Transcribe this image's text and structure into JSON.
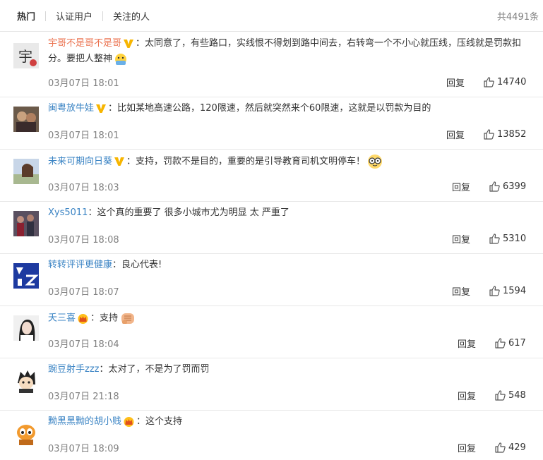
{
  "tabs": [
    "热门",
    "认证用户",
    "关注的人"
  ],
  "total": "共4491条",
  "comments": [
    {
      "user": "宇哥不是哥不是哥",
      "badge": "v",
      "text": "：太同意了，有些路口，实线恨不得划到路中间去，右转弯一个不小心就压线，压线就是罚款扣分。要把人整神",
      "emoji": "yellow",
      "time": "03月07日 18:01",
      "reply": "回复",
      "likes": "14740"
    },
    {
      "user": "闽粤放牛娃",
      "badge": "v",
      "text": "：比如某地高速公路，120限速，然后就突然来个60限速，这就是以罚款为目的",
      "emoji": "",
      "time": "03月07日 18:01",
      "reply": "回复",
      "likes": "13852"
    },
    {
      "user": "未来可期向日葵",
      "badge": "v",
      "text": "：支持，罚款不是目的，重要的是引导教育司机文明停车！",
      "emoji": "glasses",
      "time": "03月07日 18:03",
      "reply": "回复",
      "likes": "6399"
    },
    {
      "user": "Xys5011",
      "badge": "",
      "text": "：这个真的重要了 很多小城市尤为明显 太 严重了",
      "emoji": "",
      "time": "03月07日 18:08",
      "reply": "回复",
      "likes": "5310"
    },
    {
      "user": "转转评评更健康",
      "badge": "",
      "text": "：良心代表!",
      "emoji": "",
      "time": "03月07日 18:07",
      "reply": "回复",
      "likes": "1594"
    },
    {
      "user": "夭三喜",
      "badge": "crown",
      "text": "：支持",
      "emoji": "fist",
      "time": "03月07日 18:04",
      "reply": "回复",
      "likes": "617"
    },
    {
      "user": "豌豆射手zzz",
      "badge": "",
      "text": "：太对了，不是为了罚而罚",
      "emoji": "",
      "time": "03月07日 21:18",
      "reply": "回复",
      "likes": "548"
    },
    {
      "user": "黝黑黑黝的胡小贱",
      "badge": "crown",
      "text": "：这个支持",
      "emoji": "",
      "time": "03月07日 18:09",
      "reply": "回复",
      "likes": "429"
    }
  ],
  "icons": {
    "badge_v": "verified-v-icon",
    "badge_crown": "vip-crown-icon",
    "like": "thumbs-up-icon"
  },
  "colors": {
    "username": "#eb7350",
    "text": "#333333",
    "meta": "#808080",
    "badge": "#f7b500"
  }
}
